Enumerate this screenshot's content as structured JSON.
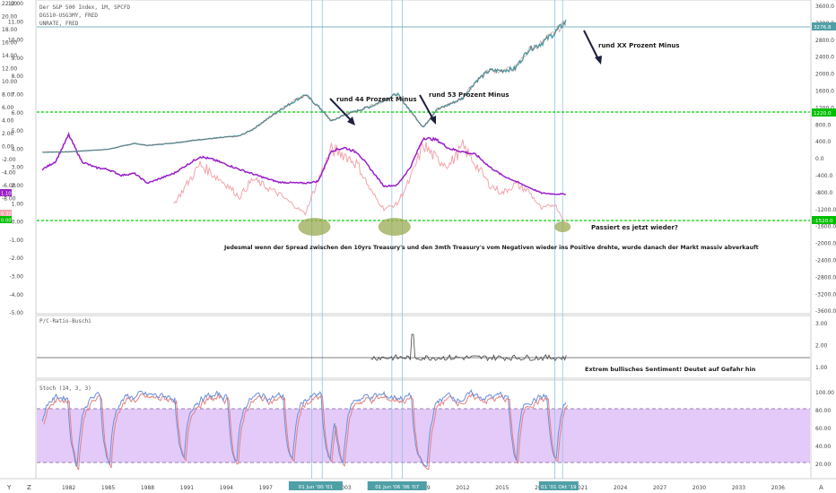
{
  "header": {
    "lines": [
      "Der S&P 500 Index, 1M, SPCFD",
      "DGS10-USG3MY, FRED",
      "UNRATE, FRED"
    ]
  },
  "colors": {
    "spx": "#4f9fa6",
    "spx_dark": "#2a6e74",
    "spread": "#9a1fc8",
    "unrate": "#f2a5ac",
    "green": "#00d400",
    "stoch_k": "#6c8fd9",
    "stoch_d": "#e58080",
    "stoch_band": "#d9b8f7",
    "vline": "#8fc6e6",
    "blob": "#9aaa50"
  },
  "axes": {
    "left_ticks": [
      "22.00",
      "20.00",
      "18.00",
      "16.00",
      "14.00",
      "12.00",
      "10.00",
      "8.00",
      "6.00",
      "4.00",
      "2.00",
      "0.00",
      "-2.00",
      "-4.00",
      "-6.00",
      "-8.00"
    ],
    "left_inner_ticks": [
      "12.00",
      "11.00",
      "10.00",
      "9.00",
      "8.00",
      "7.00",
      "6.00",
      "5.00",
      "4.00",
      "3.00",
      "2.00",
      "1.00",
      "0.00",
      "-1.00",
      "-2.00",
      "-3.00",
      "-4.00",
      "-5.00"
    ],
    "right_ticks": [
      "3600.0",
      "3200.0",
      "2800.0",
      "2400.0",
      "2000.0",
      "1600.0",
      "1200.0",
      "800.0",
      "400.0",
      "0.0",
      "-400.0",
      "-800.0",
      "-1200.0",
      "-1600.0",
      "-2000.0",
      "-2400.0",
      "-2800.0",
      "-3200.0",
      "-3600.0"
    ],
    "pc_ticks": [
      "3.00",
      "2.00",
      "1.00"
    ],
    "stoch_ticks": [
      "100.00",
      "80.00",
      "60.00",
      "40.00",
      "20.00"
    ],
    "x_ticks": [
      "1982",
      "1985",
      "1988",
      "1991",
      "1994",
      "1997",
      "2000",
      "2003",
      "2006",
      "2009",
      "2012",
      "2015",
      "2018",
      "2021",
      "2024",
      "2027",
      "2030",
      "2033",
      "2036"
    ],
    "date_labels": [
      "01 Jun '00 '01",
      "01 Jun '06 '06 '07",
      "01 '01 Okt '19"
    ],
    "right_marks": [
      "3276.8",
      "1220.0",
      "-1520.0"
    ],
    "left_marks": [
      "1.10",
      "0.32",
      "0.00"
    ]
  },
  "panes": {
    "pc_title": "P/C-Ratio-Buschi",
    "stoch_title": "Stoch (14, 3, 3)"
  },
  "annotations": {
    "a1": "rund 44 Prozent Minus",
    "a2": "rund 53 Prozent Minus",
    "a3": "rund XX Prozent Minus",
    "q": "Passiert es jetzt wieder?",
    "main": "Jedesmal wenn der Spread zwischen den 10yrs Treasury's und den 3mth Treasury's vom Negativen wieder ins Positive drehte, wurde danach der Markt massiv abverkauft",
    "pc_note": "Extrem bullisches Sentiment! Deutet auf Gefahr hin"
  },
  "corner": {
    "left": "Y",
    "z": "Z",
    "right": "A"
  },
  "chart_data": {
    "type": "line",
    "x_range": [
      1979.5,
      2038.5
    ],
    "series": [
      {
        "name": "Der S&P 500 Index",
        "x": [
          1980,
          1982,
          1985,
          1987,
          1988,
          1990,
          1992,
          1995,
          1996,
          1998,
          2000,
          2001,
          2002,
          2003,
          2005,
          2007,
          2008,
          2009,
          2010,
          2011,
          2012,
          2013,
          2014,
          2015,
          2016,
          2017,
          2018,
          2019,
          2019.9
        ],
        "y": [
          110,
          120,
          180,
          320,
          270,
          330,
          410,
          500,
          650,
          1100,
          1480,
          1200,
          850,
          1000,
          1200,
          1500,
          1100,
          700,
          1120,
          1250,
          1400,
          1800,
          2050,
          2050,
          2100,
          2550,
          2700,
          2950,
          3230
        ]
      },
      {
        "name": "DGS10-USG3MY",
        "x": [
          1980,
          1981,
          1982,
          1983,
          1984,
          1985,
          1986,
          1987,
          1988,
          1990,
          1992,
          1993,
          1995,
          1997,
          1998,
          2000,
          2001,
          2002,
          2003,
          2004,
          2005,
          2006,
          2007,
          2008,
          2009,
          2010,
          2011,
          2012,
          2013,
          2014,
          2015,
          2016,
          2017,
          2018,
          2019,
          2019.9
        ],
        "y": [
          6.0,
          6.8,
          9.5,
          6.8,
          6.2,
          6.0,
          5.4,
          5.6,
          4.6,
          5.6,
          7.3,
          7.0,
          6.0,
          5.1,
          4.7,
          4.6,
          4.8,
          7.9,
          8.2,
          7.7,
          6.0,
          4.3,
          4.4,
          6.2,
          9.2,
          9.0,
          8.1,
          7.8,
          7.5,
          6.3,
          5.4,
          4.8,
          4.2,
          3.6,
          3.5,
          3.5
        ]
      },
      {
        "name": "UNRATE",
        "x": [
          1990,
          1991,
          1992,
          1993,
          1994,
          1995,
          1996,
          1998,
          2000,
          2001,
          2002,
          2003,
          2004,
          2005,
          2006,
          2007,
          2008,
          2009,
          2010,
          2011,
          2012,
          2013,
          2014,
          2015,
          2016,
          2017,
          2018,
          2019,
          2019.9
        ],
        "y": [
          2.5,
          4.5,
          6.5,
          5.5,
          4.5,
          3.2,
          5.0,
          3.5,
          1.5,
          5.0,
          8.0,
          7.5,
          6.5,
          3.8,
          2.0,
          2.5,
          5.0,
          8.5,
          7.0,
          6.5,
          8.3,
          6.5,
          4.5,
          3.6,
          4.5,
          3.8,
          2.0,
          2.5,
          0.32
        ]
      }
    ],
    "annotations_x": [
      2000.5,
      2001.3,
      2006.6,
      2007.4,
      2019.0,
      2019.6
    ],
    "blobs_x": [
      2000.7,
      2006.8,
      2019.6
    ],
    "stoch": {
      "upper": 80,
      "lower": 20,
      "ylim": [
        8,
        108
      ]
    }
  }
}
